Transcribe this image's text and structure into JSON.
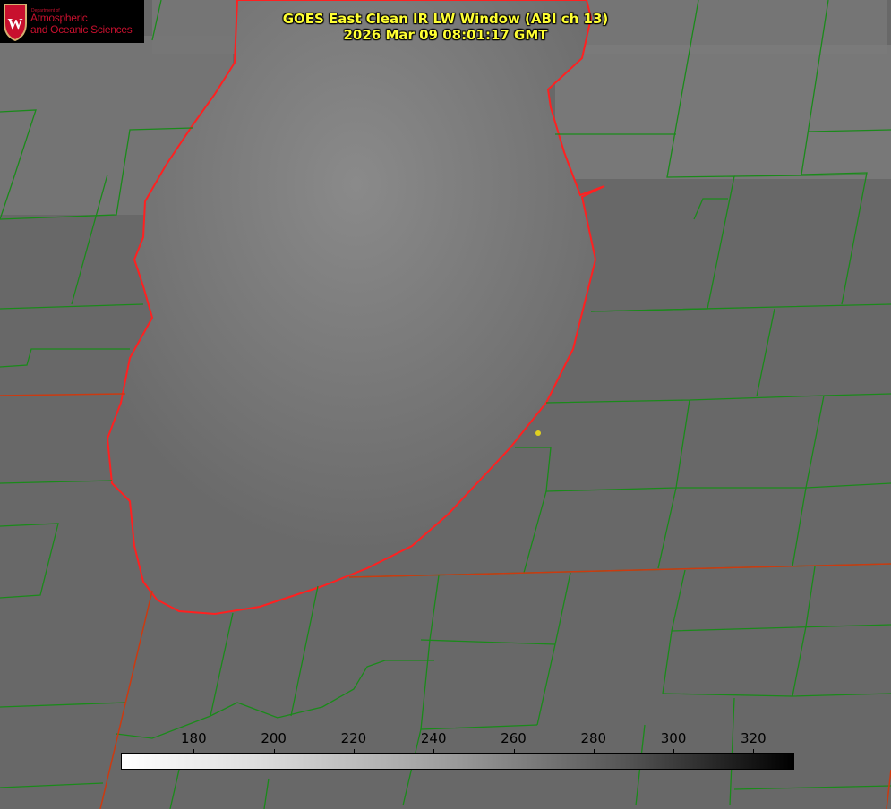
{
  "logo": {
    "small": "Department of",
    "line1": "Atmospheric",
    "line2": "and Oceanic Sciences"
  },
  "title": {
    "line1": "GOES East Clean IR LW Window (ABI ch 13)",
    "line2": "2026 Mar 09 08:01:17 GMT"
  },
  "colorbar": {
    "min": 162,
    "max": 330,
    "ticks": [
      "180",
      "200",
      "220",
      "240",
      "260",
      "280",
      "300",
      "320"
    ]
  },
  "colors": {
    "lake_outline": "#ff2020",
    "county_lines": "#1a8a1a",
    "title": "#ffff33",
    "marker": "#e0d020"
  }
}
